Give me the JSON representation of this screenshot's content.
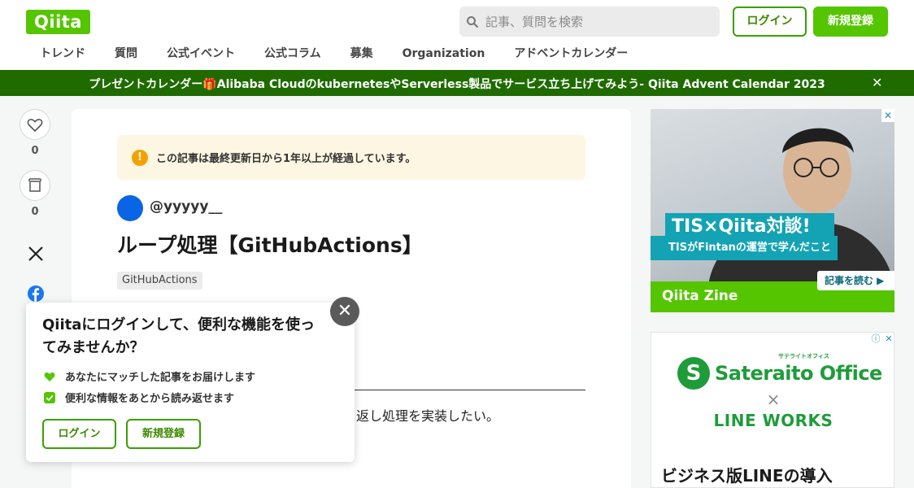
{
  "header": {
    "logo_text": "Qiita",
    "search_placeholder": "記事、質問を検索",
    "login_label": "ログイン",
    "signup_label": "新規登録",
    "brand_color": "#55c500"
  },
  "nav": {
    "items": [
      {
        "label": "トレンド"
      },
      {
        "label": "質問"
      },
      {
        "label": "公式イベント"
      },
      {
        "label": "公式コラム"
      },
      {
        "label": "募集"
      },
      {
        "label": "Organization"
      },
      {
        "label": "アドベントカレンダー"
      }
    ]
  },
  "banner": {
    "text": "プレゼントカレンダー🎁Alibaba CloudのkubernetesやServerless製品でサービス立ち上げてみよう- Qiita Advent Calendar 2023",
    "close_glyph": "✕",
    "color": "#1f6b00"
  },
  "side_actions": {
    "like_count": "0",
    "stock_count": "0"
  },
  "article": {
    "notice_icon": "!",
    "notice_text": "この記事は最終更新日から1年以上が経過しています。",
    "username": "@yyyyy__",
    "title": "ループ処理【GitHubActions】",
    "tags": [
      "GitHubActions"
    ],
    "body_fragment": "返し処理を実装したい。"
  },
  "login_popup": {
    "title": "Qiitaにログインして、便利な機能を使ってみませんか？",
    "features": [
      {
        "text": "あなたにマッチした記事をお届けします",
        "icon": "heart-icon"
      },
      {
        "text": "便利な情報をあとから読み返せます",
        "icon": "check-icon"
      }
    ],
    "login_label": "ログイン",
    "signup_label": "新規登録",
    "close_glyph": "✕"
  },
  "ads": {
    "ad1": {
      "headline": "TIS×Qiita対談!",
      "subhead": "TISがFintanの運営で学んだこと",
      "brand": "Qiita Zine",
      "cta": "記事を読む ▶",
      "close_glyph": "✕"
    },
    "ad2": {
      "logo_text": "Sateraito Office",
      "logo_small": "サテライトオフィス",
      "logo_mark": "S",
      "times": "×",
      "partner": "LINE WORKS",
      "headline": "ビジネス版LINEの導入",
      "adchoice_info": "ⓘ",
      "adchoice_close": "✕"
    }
  }
}
